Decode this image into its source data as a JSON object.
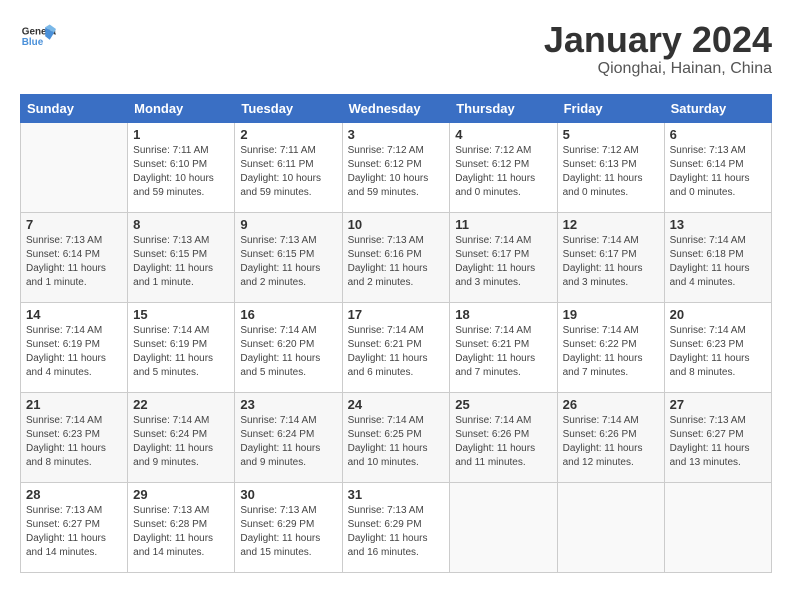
{
  "header": {
    "logo_general": "General",
    "logo_blue": "Blue",
    "month": "January 2024",
    "location": "Qionghai, Hainan, China"
  },
  "weekdays": [
    "Sunday",
    "Monday",
    "Tuesday",
    "Wednesday",
    "Thursday",
    "Friday",
    "Saturday"
  ],
  "weeks": [
    [
      {
        "day": "",
        "info": ""
      },
      {
        "day": "1",
        "info": "Sunrise: 7:11 AM\nSunset: 6:10 PM\nDaylight: 10 hours\nand 59 minutes."
      },
      {
        "day": "2",
        "info": "Sunrise: 7:11 AM\nSunset: 6:11 PM\nDaylight: 10 hours\nand 59 minutes."
      },
      {
        "day": "3",
        "info": "Sunrise: 7:12 AM\nSunset: 6:12 PM\nDaylight: 10 hours\nand 59 minutes."
      },
      {
        "day": "4",
        "info": "Sunrise: 7:12 AM\nSunset: 6:12 PM\nDaylight: 11 hours\nand 0 minutes."
      },
      {
        "day": "5",
        "info": "Sunrise: 7:12 AM\nSunset: 6:13 PM\nDaylight: 11 hours\nand 0 minutes."
      },
      {
        "day": "6",
        "info": "Sunrise: 7:13 AM\nSunset: 6:14 PM\nDaylight: 11 hours\nand 0 minutes."
      }
    ],
    [
      {
        "day": "7",
        "info": "Sunrise: 7:13 AM\nSunset: 6:14 PM\nDaylight: 11 hours\nand 1 minute."
      },
      {
        "day": "8",
        "info": "Sunrise: 7:13 AM\nSunset: 6:15 PM\nDaylight: 11 hours\nand 1 minute."
      },
      {
        "day": "9",
        "info": "Sunrise: 7:13 AM\nSunset: 6:15 PM\nDaylight: 11 hours\nand 2 minutes."
      },
      {
        "day": "10",
        "info": "Sunrise: 7:13 AM\nSunset: 6:16 PM\nDaylight: 11 hours\nand 2 minutes."
      },
      {
        "day": "11",
        "info": "Sunrise: 7:14 AM\nSunset: 6:17 PM\nDaylight: 11 hours\nand 3 minutes."
      },
      {
        "day": "12",
        "info": "Sunrise: 7:14 AM\nSunset: 6:17 PM\nDaylight: 11 hours\nand 3 minutes."
      },
      {
        "day": "13",
        "info": "Sunrise: 7:14 AM\nSunset: 6:18 PM\nDaylight: 11 hours\nand 4 minutes."
      }
    ],
    [
      {
        "day": "14",
        "info": "Sunrise: 7:14 AM\nSunset: 6:19 PM\nDaylight: 11 hours\nand 4 minutes."
      },
      {
        "day": "15",
        "info": "Sunrise: 7:14 AM\nSunset: 6:19 PM\nDaylight: 11 hours\nand 5 minutes."
      },
      {
        "day": "16",
        "info": "Sunrise: 7:14 AM\nSunset: 6:20 PM\nDaylight: 11 hours\nand 5 minutes."
      },
      {
        "day": "17",
        "info": "Sunrise: 7:14 AM\nSunset: 6:21 PM\nDaylight: 11 hours\nand 6 minutes."
      },
      {
        "day": "18",
        "info": "Sunrise: 7:14 AM\nSunset: 6:21 PM\nDaylight: 11 hours\nand 7 minutes."
      },
      {
        "day": "19",
        "info": "Sunrise: 7:14 AM\nSunset: 6:22 PM\nDaylight: 11 hours\nand 7 minutes."
      },
      {
        "day": "20",
        "info": "Sunrise: 7:14 AM\nSunset: 6:23 PM\nDaylight: 11 hours\nand 8 minutes."
      }
    ],
    [
      {
        "day": "21",
        "info": "Sunrise: 7:14 AM\nSunset: 6:23 PM\nDaylight: 11 hours\nand 8 minutes."
      },
      {
        "day": "22",
        "info": "Sunrise: 7:14 AM\nSunset: 6:24 PM\nDaylight: 11 hours\nand 9 minutes."
      },
      {
        "day": "23",
        "info": "Sunrise: 7:14 AM\nSunset: 6:24 PM\nDaylight: 11 hours\nand 9 minutes."
      },
      {
        "day": "24",
        "info": "Sunrise: 7:14 AM\nSunset: 6:25 PM\nDaylight: 11 hours\nand 10 minutes."
      },
      {
        "day": "25",
        "info": "Sunrise: 7:14 AM\nSunset: 6:26 PM\nDaylight: 11 hours\nand 11 minutes."
      },
      {
        "day": "26",
        "info": "Sunrise: 7:14 AM\nSunset: 6:26 PM\nDaylight: 11 hours\nand 12 minutes."
      },
      {
        "day": "27",
        "info": "Sunrise: 7:13 AM\nSunset: 6:27 PM\nDaylight: 11 hours\nand 13 minutes."
      }
    ],
    [
      {
        "day": "28",
        "info": "Sunrise: 7:13 AM\nSunset: 6:27 PM\nDaylight: 11 hours\nand 14 minutes."
      },
      {
        "day": "29",
        "info": "Sunrise: 7:13 AM\nSunset: 6:28 PM\nDaylight: 11 hours\nand 14 minutes."
      },
      {
        "day": "30",
        "info": "Sunrise: 7:13 AM\nSunset: 6:29 PM\nDaylight: 11 hours\nand 15 minutes."
      },
      {
        "day": "31",
        "info": "Sunrise: 7:13 AM\nSunset: 6:29 PM\nDaylight: 11 hours\nand 16 minutes."
      },
      {
        "day": "",
        "info": ""
      },
      {
        "day": "",
        "info": ""
      },
      {
        "day": "",
        "info": ""
      }
    ]
  ]
}
